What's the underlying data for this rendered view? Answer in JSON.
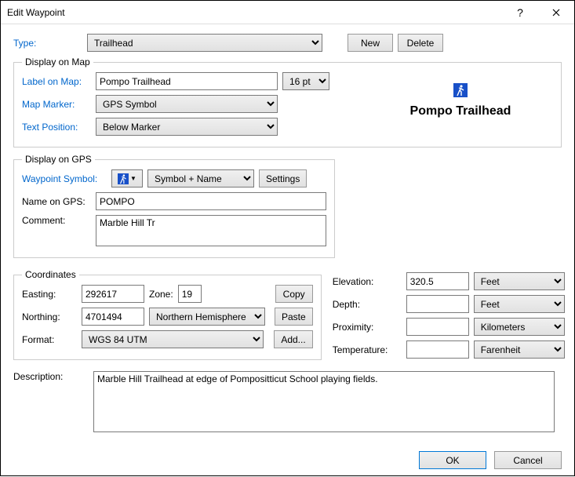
{
  "window": {
    "title": "Edit Waypoint"
  },
  "type": {
    "label": "Type:",
    "value": "Trailhead",
    "new": "New",
    "delete": "Delete"
  },
  "display_map": {
    "legend": "Display on Map",
    "label_on_map": "Label on Map:",
    "label_value": "Pompo Trailhead",
    "fontsize": "16 pt",
    "map_marker": "Map Marker:",
    "marker_value": "GPS Symbol",
    "text_position": "Text Position:",
    "text_position_value": "Below Marker"
  },
  "preview": {
    "name": "Pompo Trailhead"
  },
  "display_gps": {
    "legend": "Display on GPS",
    "waypoint_symbol": "Waypoint Symbol:",
    "mode": "Symbol + Name",
    "settings": "Settings",
    "name_on_gps": "Name on GPS:",
    "name_value": "POMPO",
    "comment": "Comment:",
    "comment_value": "Marble Hill Tr"
  },
  "coordinates": {
    "legend": "Coordinates",
    "easting": "Easting:",
    "easting_value": "292617",
    "zone": "Zone:",
    "zone_value": "19",
    "copy": "Copy",
    "northing": "Northing:",
    "northing_value": "4701494",
    "hemisphere": "Northern Hemisphere",
    "paste": "Paste",
    "format": "Format:",
    "format_value": "WGS 84 UTM",
    "add": "Add..."
  },
  "right": {
    "elevation": "Elevation:",
    "elevation_value": "320.5",
    "elevation_unit": "Feet",
    "depth": "Depth:",
    "depth_value": "",
    "depth_unit": "Feet",
    "proximity": "Proximity:",
    "proximity_value": "",
    "proximity_unit": "Kilometers",
    "temperature": "Temperature:",
    "temperature_value": "",
    "temperature_unit": "Farenheit"
  },
  "description": {
    "label": "Description:",
    "value": "Marble Hill Trailhead at edge of Pompositticut School playing fields."
  },
  "footer": {
    "ok": "OK",
    "cancel": "Cancel"
  }
}
